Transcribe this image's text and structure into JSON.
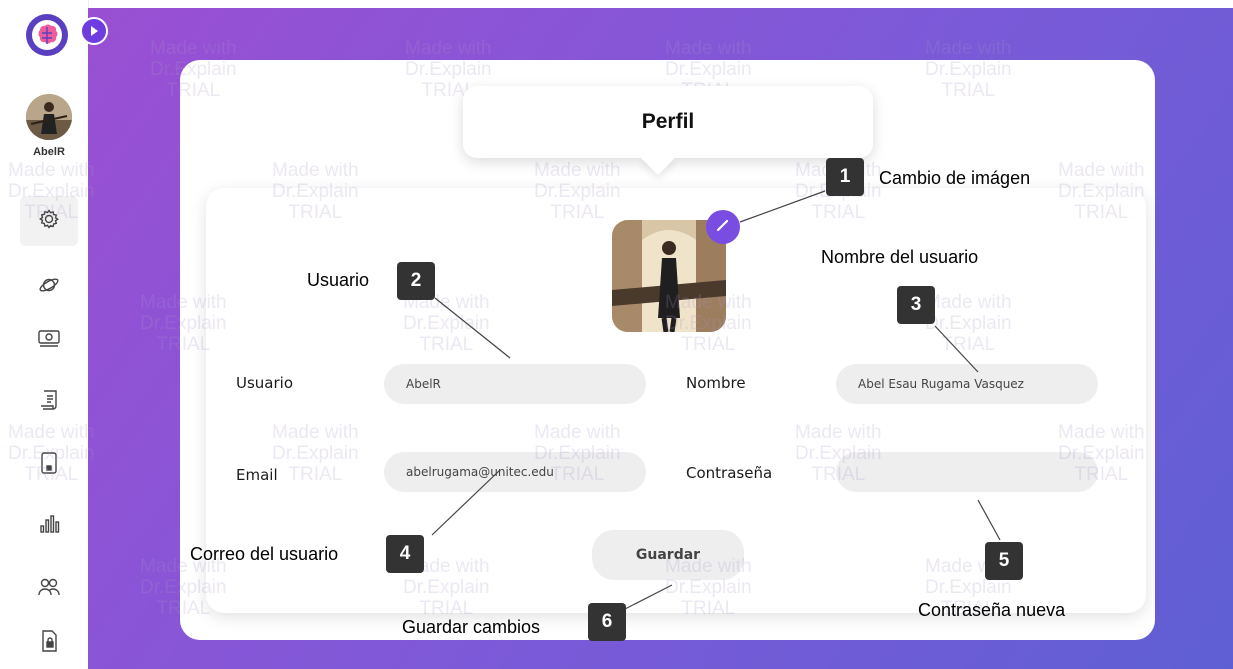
{
  "user": {
    "name": "AbelR"
  },
  "sidebar": {
    "items": [
      {
        "icon": "settings-icon"
      },
      {
        "icon": "planet-icon"
      },
      {
        "icon": "money-icon"
      },
      {
        "icon": "receipt-icon"
      },
      {
        "icon": "device-icon"
      },
      {
        "icon": "bar-chart-icon"
      },
      {
        "icon": "users-icon"
      },
      {
        "icon": "secure-file-icon"
      }
    ]
  },
  "page": {
    "title": "Perfil"
  },
  "form": {
    "usuario_label": "Usuario",
    "usuario_value": "AbelR",
    "nombre_label": "Nombre",
    "nombre_value": "Abel Esau Rugama Vasquez",
    "email_label": "Email",
    "email_value": "abelrugama@unitec.edu",
    "password_label": "Contraseña",
    "password_value": "",
    "save_label": "Guardar"
  },
  "watermark": {
    "line1": "Made with",
    "line2": "Dr.Explain",
    "line3": "TRIAL"
  },
  "callouts": [
    {
      "number": "1",
      "text": "Cambio de imágen"
    },
    {
      "number": "2",
      "text": "Usuario"
    },
    {
      "number": "3",
      "text": "Nombre del usuario"
    },
    {
      "number": "4",
      "text": "Correo del usuario"
    },
    {
      "number": "5",
      "text": "Contraseña nueva"
    },
    {
      "number": "6",
      "text": "Guardar cambios"
    }
  ],
  "colors": {
    "accent": "#7a4de2",
    "background_gradient_start": "#9a4fd3",
    "background_gradient_end": "#5f5fd4",
    "callout": "#333333"
  }
}
